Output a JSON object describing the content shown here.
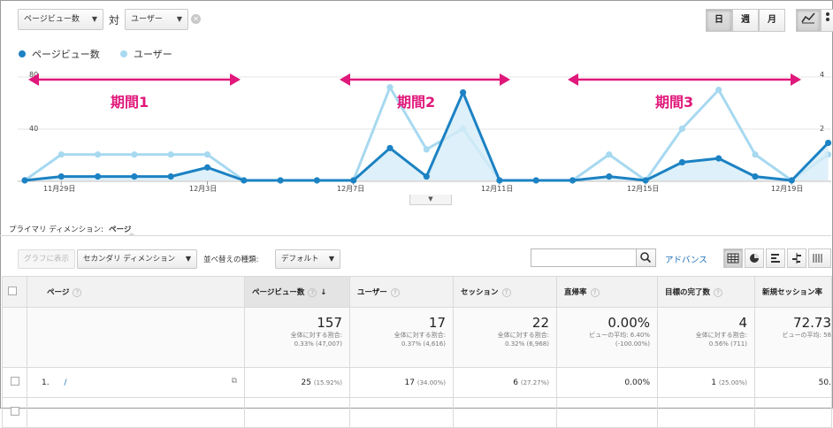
{
  "controls": {
    "metric1": "ページビュー数",
    "vs": "対",
    "metric2": "ユーザー",
    "day": "日",
    "week": "週",
    "month": "月"
  },
  "legend": {
    "series1": "ページビュー数",
    "series2": "ユーザー",
    "color1": "#1c82c3",
    "color2": "#a7d9f0"
  },
  "annotations": {
    "period1": "期間1",
    "period2": "期間2",
    "period3": "期間3",
    "color": "#e0187b"
  },
  "chart_data": {
    "type": "line",
    "x": [
      "11月28日",
      "11月29日",
      "11月30日",
      "12月1日",
      "12月2日",
      "12月3日",
      "12月4日",
      "12月5日",
      "12月6日",
      "12月7日",
      "12月8日",
      "12月9日",
      "12月10日",
      "12月11日",
      "12月12日",
      "12月13日",
      "12月14日",
      "12月15日",
      "12月16日",
      "12月17日",
      "12月18日",
      "12月19日",
      "12月20日"
    ],
    "x_tick_labels": [
      "11月29日",
      "12月3日",
      "12月7日",
      "12月11日",
      "12月15日",
      "12月19日"
    ],
    "left_axis": {
      "ticks": [
        "40",
        "80"
      ],
      "ylim": [
        0,
        80
      ]
    },
    "right_axis": {
      "ticks": [
        "2",
        "4"
      ],
      "ylim": [
        0,
        4
      ]
    },
    "series": [
      {
        "name": "ページビュー数",
        "axis": "left",
        "values": [
          0,
          3,
          3,
          3,
          3,
          10,
          0,
          0,
          0,
          0,
          25,
          3,
          68,
          0,
          0,
          0,
          3,
          0,
          14,
          17,
          3,
          0,
          29
        ]
      },
      {
        "name": "ユーザー",
        "axis": "right",
        "values": [
          0,
          1,
          1,
          1,
          1,
          1,
          0,
          0,
          0,
          0,
          3.6,
          1.2,
          2,
          0,
          0,
          0,
          1,
          0,
          2,
          3.5,
          1,
          0,
          1
        ]
      }
    ]
  },
  "dimension": {
    "label": "プライマリ ディメンション:",
    "value": "ページ"
  },
  "toolbar": {
    "plot": "グラフに表示",
    "secondary": "セカンダリ ディメンション",
    "sort_label": "並べ替えの種類:",
    "sort_value": "デフォルト",
    "search_value": "",
    "advanced": "アドバンス"
  },
  "table": {
    "headers": [
      "ページ",
      "ページビュー数",
      "ユーザー",
      "セッション",
      "直帰率",
      "目標の完了数",
      "新規セッション率"
    ],
    "summary": [
      {
        "value": "157",
        "l1": "全体に対する割合:",
        "l2": "0.33% (47,007)"
      },
      {
        "value": "17",
        "l1": "全体に対する割合:",
        "l2": "0.37% (4,616)"
      },
      {
        "value": "22",
        "l1": "全体に対する割合:",
        "l2": "0.32% (6,968)"
      },
      {
        "value": "0.00%",
        "l1": "ビューの平均: 6.40%",
        "l2": "(-100.00%)"
      },
      {
        "value": "4",
        "l1": "全体に対する割合:",
        "l2": "0.56% (711)"
      },
      {
        "value": "72.73",
        "l1": "ビューの平均: 58",
        "l2": ""
      }
    ],
    "rows": [
      {
        "index": "1.",
        "page": "/",
        "pv": "25",
        "pv_pct": "(15.92%)",
        "users": "17",
        "users_pct": "(34.00%)",
        "sessions": "6",
        "sessions_pct": "(27.27%)",
        "bounce": "0.00%",
        "goals": "1",
        "goals_pct": "(25.00%)",
        "new": "50."
      }
    ]
  }
}
